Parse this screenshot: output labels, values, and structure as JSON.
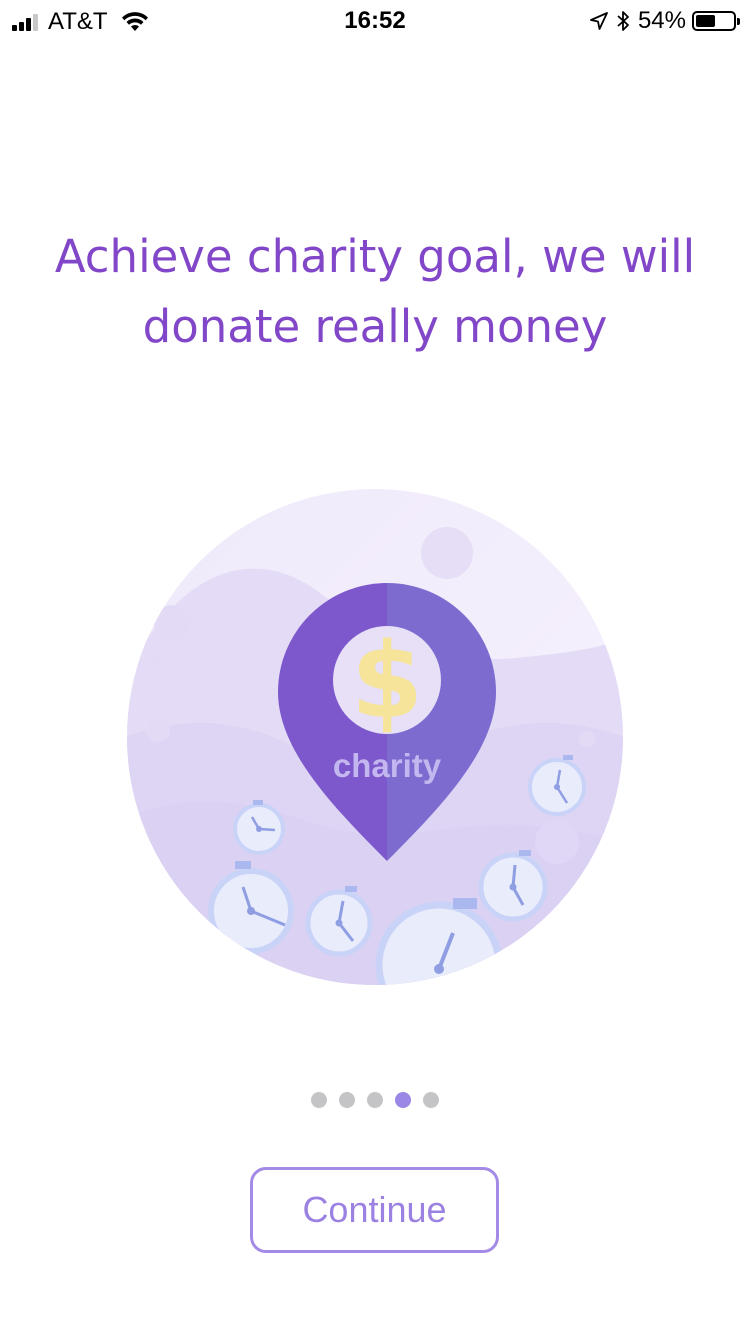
{
  "status_bar": {
    "carrier": "AT&T",
    "time": "16:52",
    "battery_percent_label": "54%",
    "battery_level": 0.54,
    "icons": [
      "signal-icon",
      "wifi-icon",
      "location-arrow-icon",
      "bluetooth-icon",
      "battery-icon"
    ]
  },
  "onboarding": {
    "headline_line1": "Achieve charity goal, we will",
    "headline_line2": "donate really money",
    "illustration": {
      "pin_symbol": "$",
      "pin_label": "charity"
    },
    "pagination": {
      "total": 5,
      "active_index": 3
    },
    "continue_label": "Continue"
  },
  "colors": {
    "accent": "#8147c8",
    "button_border": "#a38ae6",
    "dot_active": "#9b87e6",
    "dot_inactive": "#c4c4c6",
    "pin_left": "#7c58cc",
    "pin_right": "#7d6bd0",
    "coin": "#f5e49a"
  }
}
